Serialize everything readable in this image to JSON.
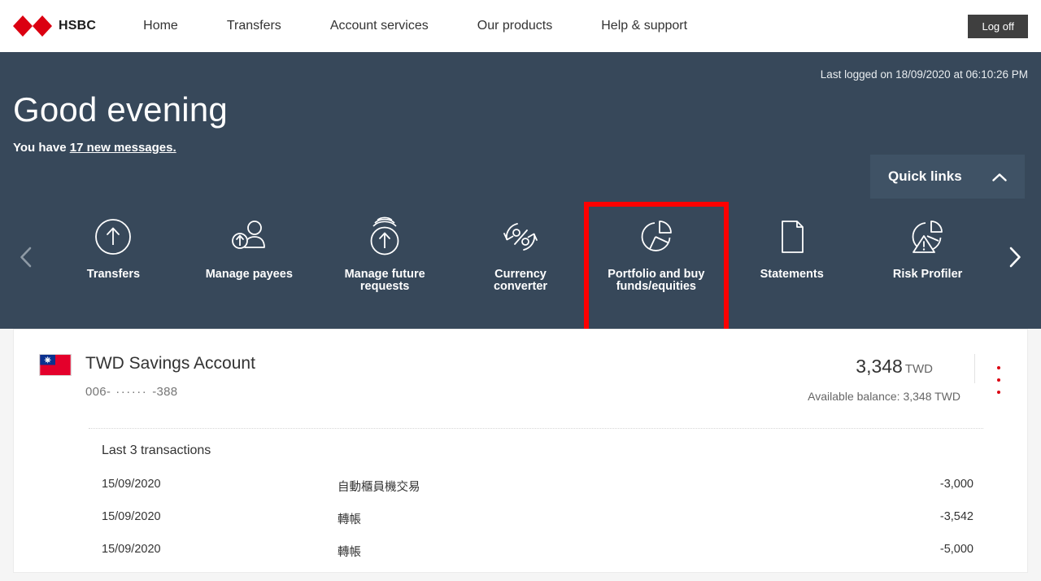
{
  "header": {
    "brand": "HSBC",
    "logo_icon": "hsbc-hexagon-logo",
    "nav": [
      {
        "label": "Home"
      },
      {
        "label": "Transfers"
      },
      {
        "label": "Account services"
      },
      {
        "label": "Our products"
      },
      {
        "label": "Help & support"
      }
    ],
    "logoff_label": "Log off"
  },
  "hero": {
    "last_logged": "Last logged on 18/09/2020 at 06:10:26 PM",
    "greeting": "Good evening",
    "messages_prefix": "You have ",
    "messages_link": "17 new messages.",
    "background_color": "#37485a"
  },
  "quick_links": {
    "title": "Quick links",
    "toggle_icon": "chevron-up-icon",
    "prev_icon": "chevron-left-icon",
    "next_icon": "chevron-right-icon",
    "highlight_color": "#fe0000",
    "items": [
      {
        "label": "Transfers",
        "icon": "arrow-up-circle-icon",
        "highlighted": false
      },
      {
        "label": "Manage payees",
        "icon": "person-arrow-icon",
        "highlighted": false
      },
      {
        "label": "Manage future requests",
        "icon": "future-arrow-up-circle-icon",
        "highlighted": false
      },
      {
        "label": "Currency converter",
        "icon": "percent-refresh-icon",
        "highlighted": false
      },
      {
        "label": "Portfolio and buy funds/equities",
        "icon": "pie-chart-icon",
        "highlighted": true
      },
      {
        "label": "Statements",
        "icon": "document-icon",
        "highlighted": false
      },
      {
        "label": "Risk Profiler",
        "icon": "pie-chart-warning-icon",
        "highlighted": false
      }
    ]
  },
  "account": {
    "flag_icon": "taiwan-flag-icon",
    "name": "TWD Savings Account",
    "number_prefix": "006-",
    "number_mask": "······",
    "number_suffix": "-388",
    "balance_amount": "3,348",
    "balance_currency": "TWD",
    "available_balance": "Available balance: 3,348 TWD",
    "menu_icon": "kebab-menu-icon",
    "transactions_title": "Last 3 transactions",
    "transactions": [
      {
        "date": "15/09/2020",
        "description": "自動櫃員機交易",
        "amount": "-3,000"
      },
      {
        "date": "15/09/2020",
        "description": "轉帳",
        "amount": "-3,542"
      },
      {
        "date": "15/09/2020",
        "description": "轉帳",
        "amount": "-5,000"
      }
    ]
  }
}
